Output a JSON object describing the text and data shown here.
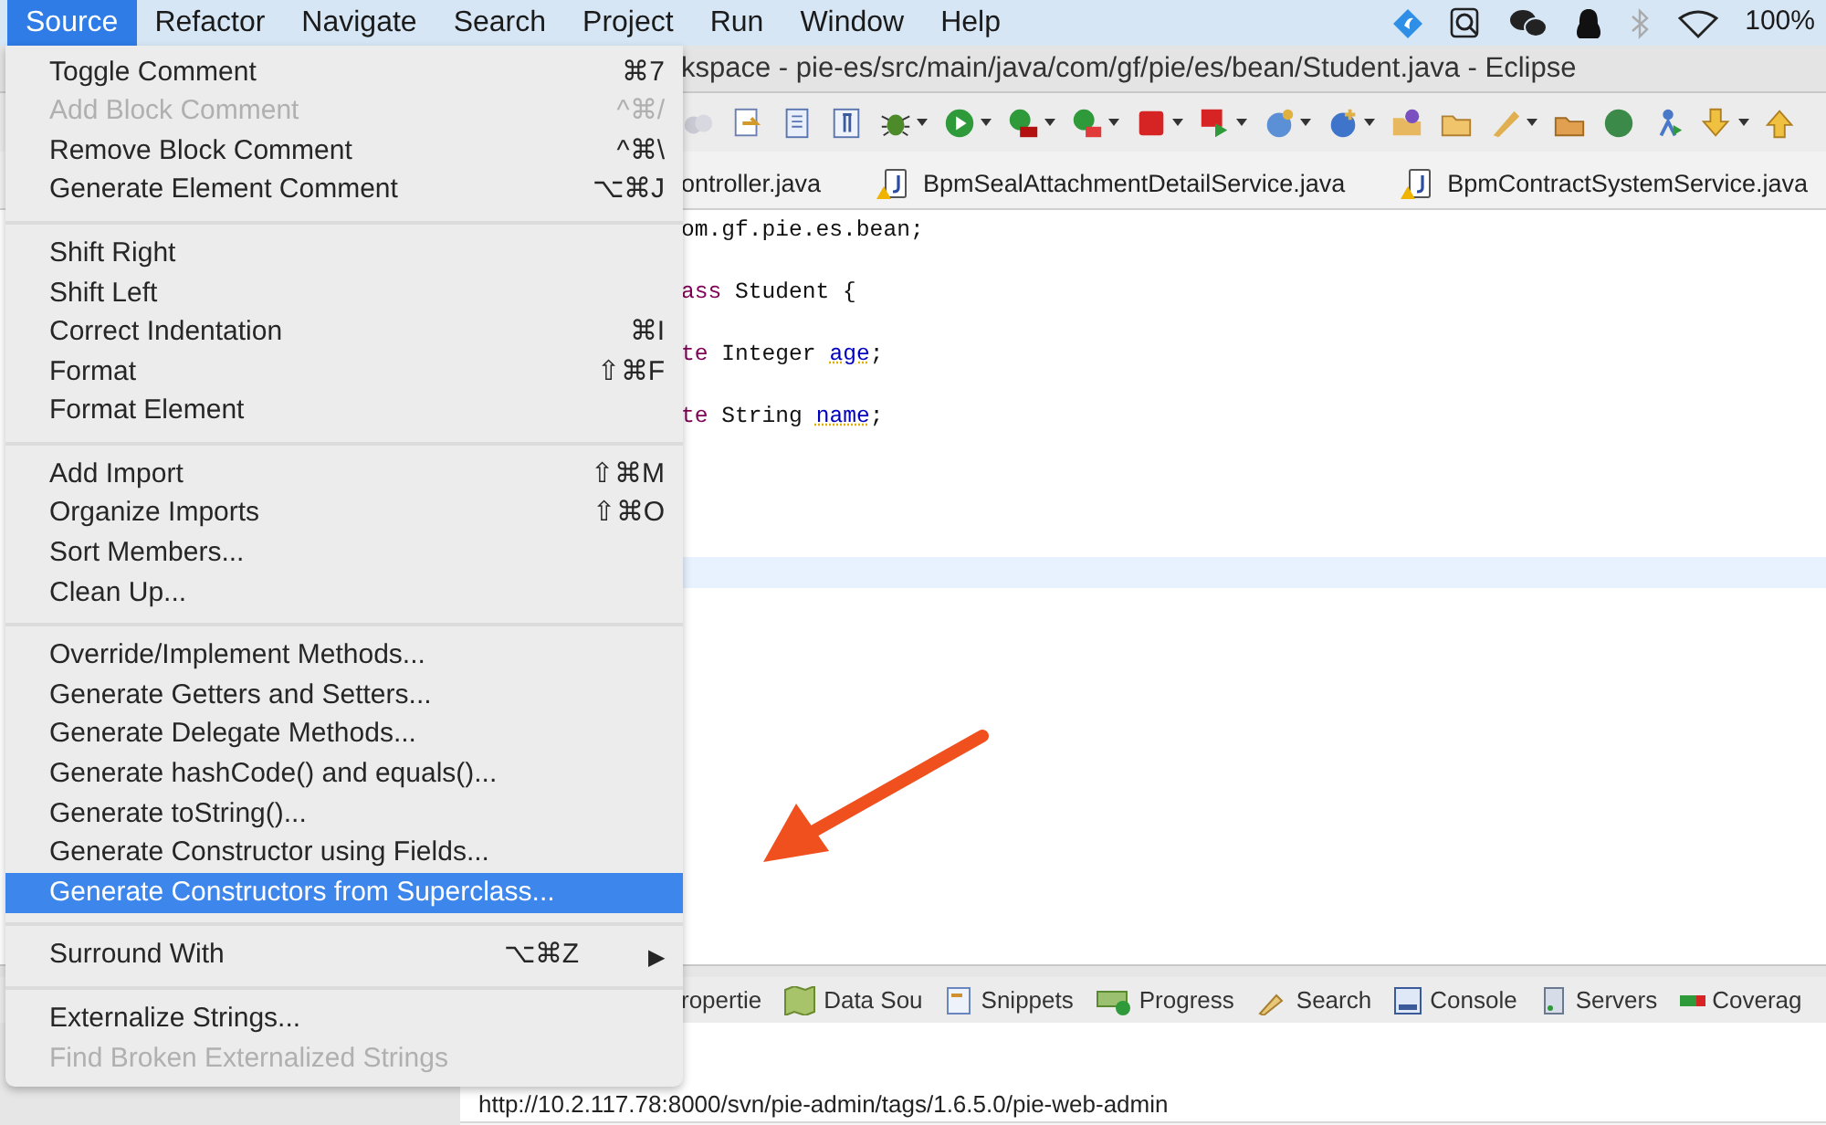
{
  "menubar": {
    "items": [
      {
        "label": "Source",
        "selected": true
      },
      {
        "label": "Refactor",
        "selected": false
      },
      {
        "label": "Navigate",
        "selected": false
      },
      {
        "label": "Search",
        "selected": false
      },
      {
        "label": "Project",
        "selected": false
      },
      {
        "label": "Run",
        "selected": false
      },
      {
        "label": "Window",
        "selected": false
      },
      {
        "label": "Help",
        "selected": false
      }
    ],
    "battery": "100%"
  },
  "window": {
    "title": "kspace - pie-es/src/main/java/com/gf/pie/es/bean/Student.java - Eclipse"
  },
  "editor_tabs": [
    {
      "label": "ontroller.java"
    },
    {
      "label": "BpmSealAttachmentDetailService.java",
      "warning": true
    },
    {
      "label": "BpmContractSystemService.java",
      "warning": true
    }
  ],
  "code_lines": [
    {
      "tokens": [
        {
          "text": "om.gf.pie.es.bean;",
          "kind": "plain"
        }
      ]
    },
    {
      "tokens": [
        {
          "text": "ass",
          "kind": "keyword"
        },
        {
          "text": " Student {",
          "kind": "plain"
        }
      ]
    },
    {
      "tokens": [
        {
          "text": "te",
          "kind": "keyword"
        },
        {
          "text": " Integer ",
          "kind": "plain"
        },
        {
          "text": "age",
          "kind": "field",
          "warning": true
        },
        {
          "text": ";",
          "kind": "plain"
        }
      ]
    },
    {
      "tokens": [
        {
          "text": "te",
          "kind": "keyword"
        },
        {
          "text": " String ",
          "kind": "plain"
        },
        {
          "text": "name",
          "kind": "field",
          "warning": true
        },
        {
          "text": ";",
          "kind": "plain"
        }
      ]
    }
  ],
  "panel_tabs": [
    "ropertie",
    "Data Sou",
    "Snippets",
    "Progress",
    "Search",
    "Console",
    "Servers",
    "Coverag"
  ],
  "repository_url": "http://10.2.117.78:8000/svn/pie-admin/tags/1.6.5.0/pie-web-admin",
  "menu": {
    "groups": [
      {
        "items": [
          {
            "label": "Toggle Comment",
            "shortcut": "⌘7",
            "disabled": false,
            "selected": false
          },
          {
            "label": "Add Block Comment",
            "shortcut": "^⌘/",
            "disabled": true,
            "selected": false
          },
          {
            "label": "Remove Block Comment",
            "shortcut": "^⌘\\",
            "disabled": false,
            "selected": false
          },
          {
            "label": "Generate Element Comment",
            "shortcut": "⌥⌘J",
            "disabled": false,
            "selected": false
          }
        ]
      },
      {
        "items": [
          {
            "label": "Shift Right",
            "disabled": false,
            "selected": false
          },
          {
            "label": "Shift Left",
            "disabled": false,
            "selected": false
          },
          {
            "label": "Correct Indentation",
            "shortcut": "⌘I",
            "disabled": false,
            "selected": false
          },
          {
            "label": "Format",
            "shortcut": "⇧⌘F",
            "disabled": false,
            "selected": false
          },
          {
            "label": "Format Element",
            "disabled": false,
            "selected": false
          }
        ]
      },
      {
        "items": [
          {
            "label": "Add Import",
            "shortcut": "⇧⌘M",
            "disabled": false,
            "selected": false
          },
          {
            "label": "Organize Imports",
            "shortcut": "⇧⌘O",
            "disabled": false,
            "selected": false
          },
          {
            "label": "Sort Members...",
            "disabled": false,
            "selected": false
          },
          {
            "label": "Clean Up...",
            "disabled": false,
            "selected": false
          }
        ]
      },
      {
        "items": [
          {
            "label": "Override/Implement Methods...",
            "disabled": false,
            "selected": false
          },
          {
            "label": "Generate Getters and Setters...",
            "disabled": false,
            "selected": false
          },
          {
            "label": "Generate Delegate Methods...",
            "disabled": false,
            "selected": false
          },
          {
            "label": "Generate hashCode() and equals()...",
            "disabled": false,
            "selected": false
          },
          {
            "label": "Generate toString()...",
            "disabled": false,
            "selected": false
          },
          {
            "label": "Generate Constructor using Fields...",
            "disabled": false,
            "selected": false
          },
          {
            "label": "Generate Constructors from Superclass...",
            "disabled": false,
            "selected": true
          }
        ]
      },
      {
        "items": [
          {
            "label": "Surround With",
            "shortcut": "⌥⌘Z",
            "submenu": "▶",
            "disabled": false,
            "selected": false
          }
        ]
      },
      {
        "items": [
          {
            "label": "Externalize Strings...",
            "disabled": false,
            "selected": false
          },
          {
            "label": "Find Broken Externalized Strings",
            "disabled": true,
            "selected": false
          }
        ]
      }
    ]
  }
}
